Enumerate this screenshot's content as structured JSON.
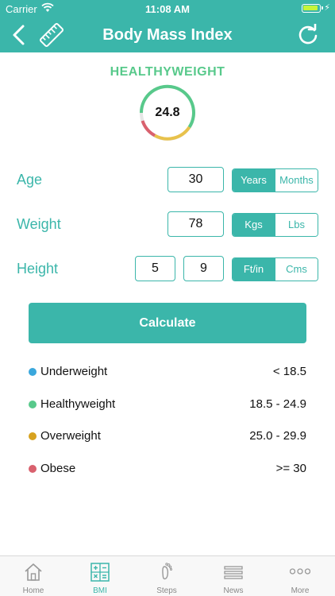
{
  "status_bar": {
    "carrier": "Carrier",
    "time": "11:08 AM"
  },
  "header": {
    "title": "Body Mass Index"
  },
  "result": {
    "status": "HEALTHYWEIGHT",
    "bmi": "24.8"
  },
  "form": {
    "age": {
      "label": "Age",
      "value": "30",
      "units": [
        "Years",
        "Months"
      ],
      "selected": "Years"
    },
    "weight": {
      "label": "Weight",
      "value": "78",
      "units": [
        "Kgs",
        "Lbs"
      ],
      "selected": "Kgs"
    },
    "height": {
      "label": "Height",
      "feet": "5",
      "inches": "9",
      "units": [
        "Ft/in",
        "Cms"
      ],
      "selected": "Ft/in"
    }
  },
  "calculate_label": "Calculate",
  "legend": [
    {
      "name": "Underweight",
      "range": "< 18.5",
      "color": "#3aa7dc"
    },
    {
      "name": "Healthyweight",
      "range": "18.5 - 24.9",
      "color": "#58c98b"
    },
    {
      "name": "Overweight",
      "range": "25.0 - 29.9",
      "color": "#d7a21f"
    },
    {
      "name": "Obese",
      "range": ">= 30",
      "color": "#d9616e"
    }
  ],
  "tabs": [
    {
      "label": "Home",
      "icon": "home-icon"
    },
    {
      "label": "BMI",
      "icon": "calculator-icon",
      "active": true
    },
    {
      "label": "Steps",
      "icon": "footprint-icon"
    },
    {
      "label": "News",
      "icon": "news-icon"
    },
    {
      "label": "More",
      "icon": "more-icon"
    }
  ],
  "colors": {
    "accent": "#3bb6aa",
    "healthy": "#58c98b"
  }
}
